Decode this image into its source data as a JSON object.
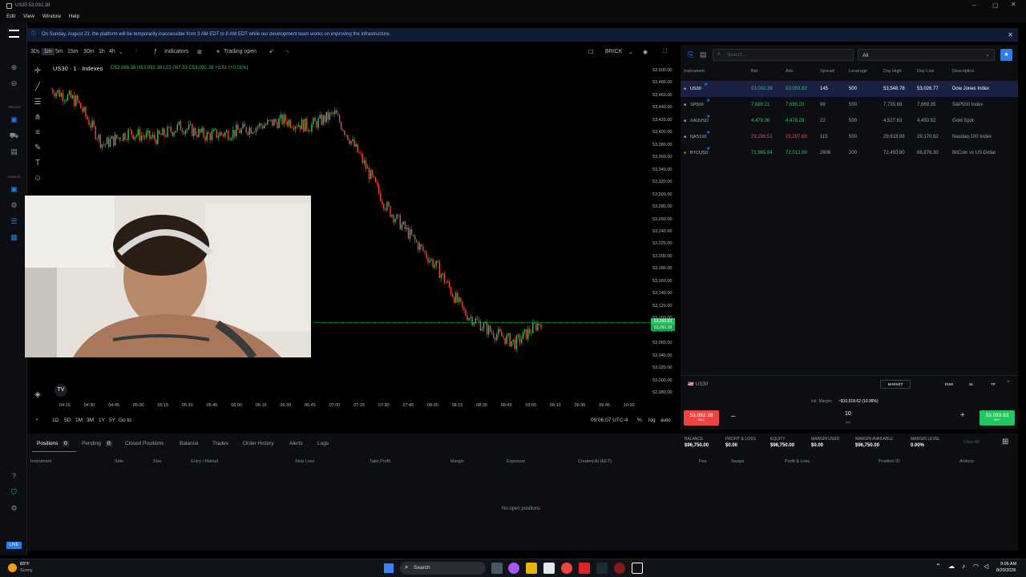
{
  "window": {
    "title": "US30 53,092.38"
  },
  "menu": [
    "Edit",
    "View",
    "Window",
    "Help"
  ],
  "leftnav": {
    "spaces_label": "SPACES",
    "panels_label": "PANELS",
    "live_badge": "LIVE"
  },
  "notice": {
    "text": "On Sunday, August 23, the platform will be temporarily inaccessible from 3 AM EDT to 8 AM EDT while our development team works on improving the infrastructure."
  },
  "toolbar": {
    "timeframes": [
      "30s",
      "1m",
      "5m",
      "15m",
      "30m",
      "1h",
      "4h"
    ],
    "selected_timeframe": "1m",
    "indicators_label": "Indicators",
    "trading_status": "Trading open",
    "brick_label": "BRICK"
  },
  "chart": {
    "symbol_line": "US30 · 1 · Indexes",
    "ohlc": "O53,088.36  H53,092.38  L53,087.33  C53,092.38  +3.51 (+0.01%)",
    "last_ask_tag": "53,093.83",
    "last_bid_tag": "53,092.38",
    "colors": {
      "up": "#22c55e",
      "down": "#ef4444",
      "wick_down": "#d34c4c"
    }
  },
  "chart_data": {
    "type": "line",
    "title": "",
    "xlabel": "",
    "ylabel": "",
    "x": [
      "04:15",
      "04:30",
      "04:45",
      "05:00",
      "05:15",
      "05:30",
      "05:45",
      "06:00",
      "06:15",
      "06:30",
      "06:45",
      "07:00",
      "07:15",
      "07:30",
      "07:45",
      "08:00",
      "08:15",
      "08:30",
      "08:45",
      "09:00"
    ],
    "series": [
      {
        "values": [
          53470,
          53450,
          53380,
          53400,
          53390,
          53410,
          53395,
          53400,
          53410,
          53420,
          53410,
          53430,
          53360,
          53280,
          53230,
          53180,
          53110,
          53080,
          53060,
          53095
        ]
      }
    ],
    "ylim": [
      52980,
      53500
    ],
    "y_ticks": [
      "53,500.00",
      "53,480.00",
      "53,460.00",
      "53,440.00",
      "53,420.00",
      "53,400.00",
      "53,380.00",
      "53,360.00",
      "53,340.00",
      "53,320.00",
      "53,300.00",
      "53,280.00",
      "53,260.00",
      "53,240.00",
      "53,220.00",
      "53,200.00",
      "53,180.00",
      "53,160.00",
      "53,140.00",
      "53,120.00",
      "53,100.00",
      "53,080.00",
      "53,060.00",
      "53,040.00",
      "53,020.00",
      "53,000.00",
      "52,980.00"
    ],
    "x_ticks": [
      "04:15",
      "04:30",
      "04:45",
      "05:00",
      "05:15",
      "05:30",
      "05:45",
      "06:00",
      "06:15",
      "06:30",
      "06:45",
      "07:00",
      "07:15",
      "07:30",
      "07:45",
      "08:00",
      "08:15",
      "08:30",
      "08:45",
      "09:00",
      "09:15",
      "09:30",
      "09:45",
      "10:00"
    ],
    "price_line": 53093
  },
  "rangebar": {
    "ranges": [
      "1D",
      "5D",
      "1M",
      "3M",
      "1Y",
      "5Y",
      "Go to"
    ],
    "clock": "09:06:07 UTC-4",
    "pct": "%",
    "log": "log",
    "auto": "auto"
  },
  "watchlist": {
    "search_placeholder": "Search...",
    "filter": "All",
    "headers": [
      "Instrument",
      "Bid",
      "Ask",
      "Spread",
      "Leverage",
      "Day High",
      "Day Low",
      "Description"
    ],
    "rows": [
      {
        "sym": "US30",
        "bid": "53,092.38",
        "ask": "53,093.83",
        "spread": "145",
        "lev": "500",
        "high": "53,548.78",
        "low": "53,026.77",
        "desc": "Dow Jones Index"
      },
      {
        "sym": "SP500",
        "bid": "7,689.21",
        "ask": "7,690.20",
        "spread": "99",
        "lev": "500",
        "high": "7,735.69",
        "low": "7,669.35",
        "desc": "S&P500 Index"
      },
      {
        "sym": "XAUUSD",
        "bid": "4,478.06",
        "ask": "4,478.28",
        "spread": "22",
        "lev": "500",
        "high": "4,527.63",
        "low": "4,450.52",
        "desc": "Gold Spot"
      },
      {
        "sym": "NAS100",
        "bid": "29,296.51",
        "ask": "29,297.66",
        "spread": "115",
        "lev": "500",
        "high": "29,618.98",
        "low": "29,170.82",
        "desc": "Nasdaq-100 Index"
      },
      {
        "sym": "BTCUSD",
        "bid": "71,985.94",
        "ask": "72,012.00",
        "spread": "2606",
        "lev": "200",
        "high": "72,493.80",
        "low": "68,876.30",
        "desc": "BitCoin vs US Dollar"
      }
    ]
  },
  "order": {
    "symbol": "US30",
    "type": "MARKET",
    "risk": "RISK",
    "sl": "SL",
    "tp": "TP",
    "margin_label": "Init. Margin:",
    "margin_value": "~$10,618.62 (10.99%)",
    "sell_price": "53,092.38",
    "sell": "SELL",
    "qty": "10",
    "unit": "lots",
    "buy_price": "53,093.83",
    "buy": "BUY"
  },
  "account": [
    {
      "label": "BALANCE",
      "value": "$96,750.00"
    },
    {
      "label": "PROFIT & LOSS",
      "value": "$0.00"
    },
    {
      "label": "EQUITY",
      "value": "$96,750.00"
    },
    {
      "label": "MARGIN USED",
      "value": "$0.00"
    },
    {
      "label": "MARGIN AVAILABLE",
      "value": "$96,750.00"
    },
    {
      "label": "MARGIN LEVEL",
      "value": "0.00%"
    }
  ],
  "close_all": "Close All",
  "bottom": {
    "tabs": [
      "Positions",
      "Pending",
      "Closed Positions",
      "Balance",
      "Trades",
      "Order History",
      "Alerts",
      "Logs"
    ],
    "positions_count": "0",
    "pending_count": "0",
    "columns": [
      "Instrument",
      "Side",
      "Size",
      "Entry / Market",
      "Stop Loss",
      "Take Profit",
      "Margin",
      "Exposure",
      "Created At (EET)",
      "Fee",
      "Swaps",
      "Profit & Loss",
      "Position ID",
      "Actions"
    ],
    "empty": "No open positions"
  },
  "taskbar": {
    "temp": "83°F",
    "weather": "Sunny",
    "search": "Search",
    "time": "9:06 AM",
    "date": "8/20/2026"
  }
}
